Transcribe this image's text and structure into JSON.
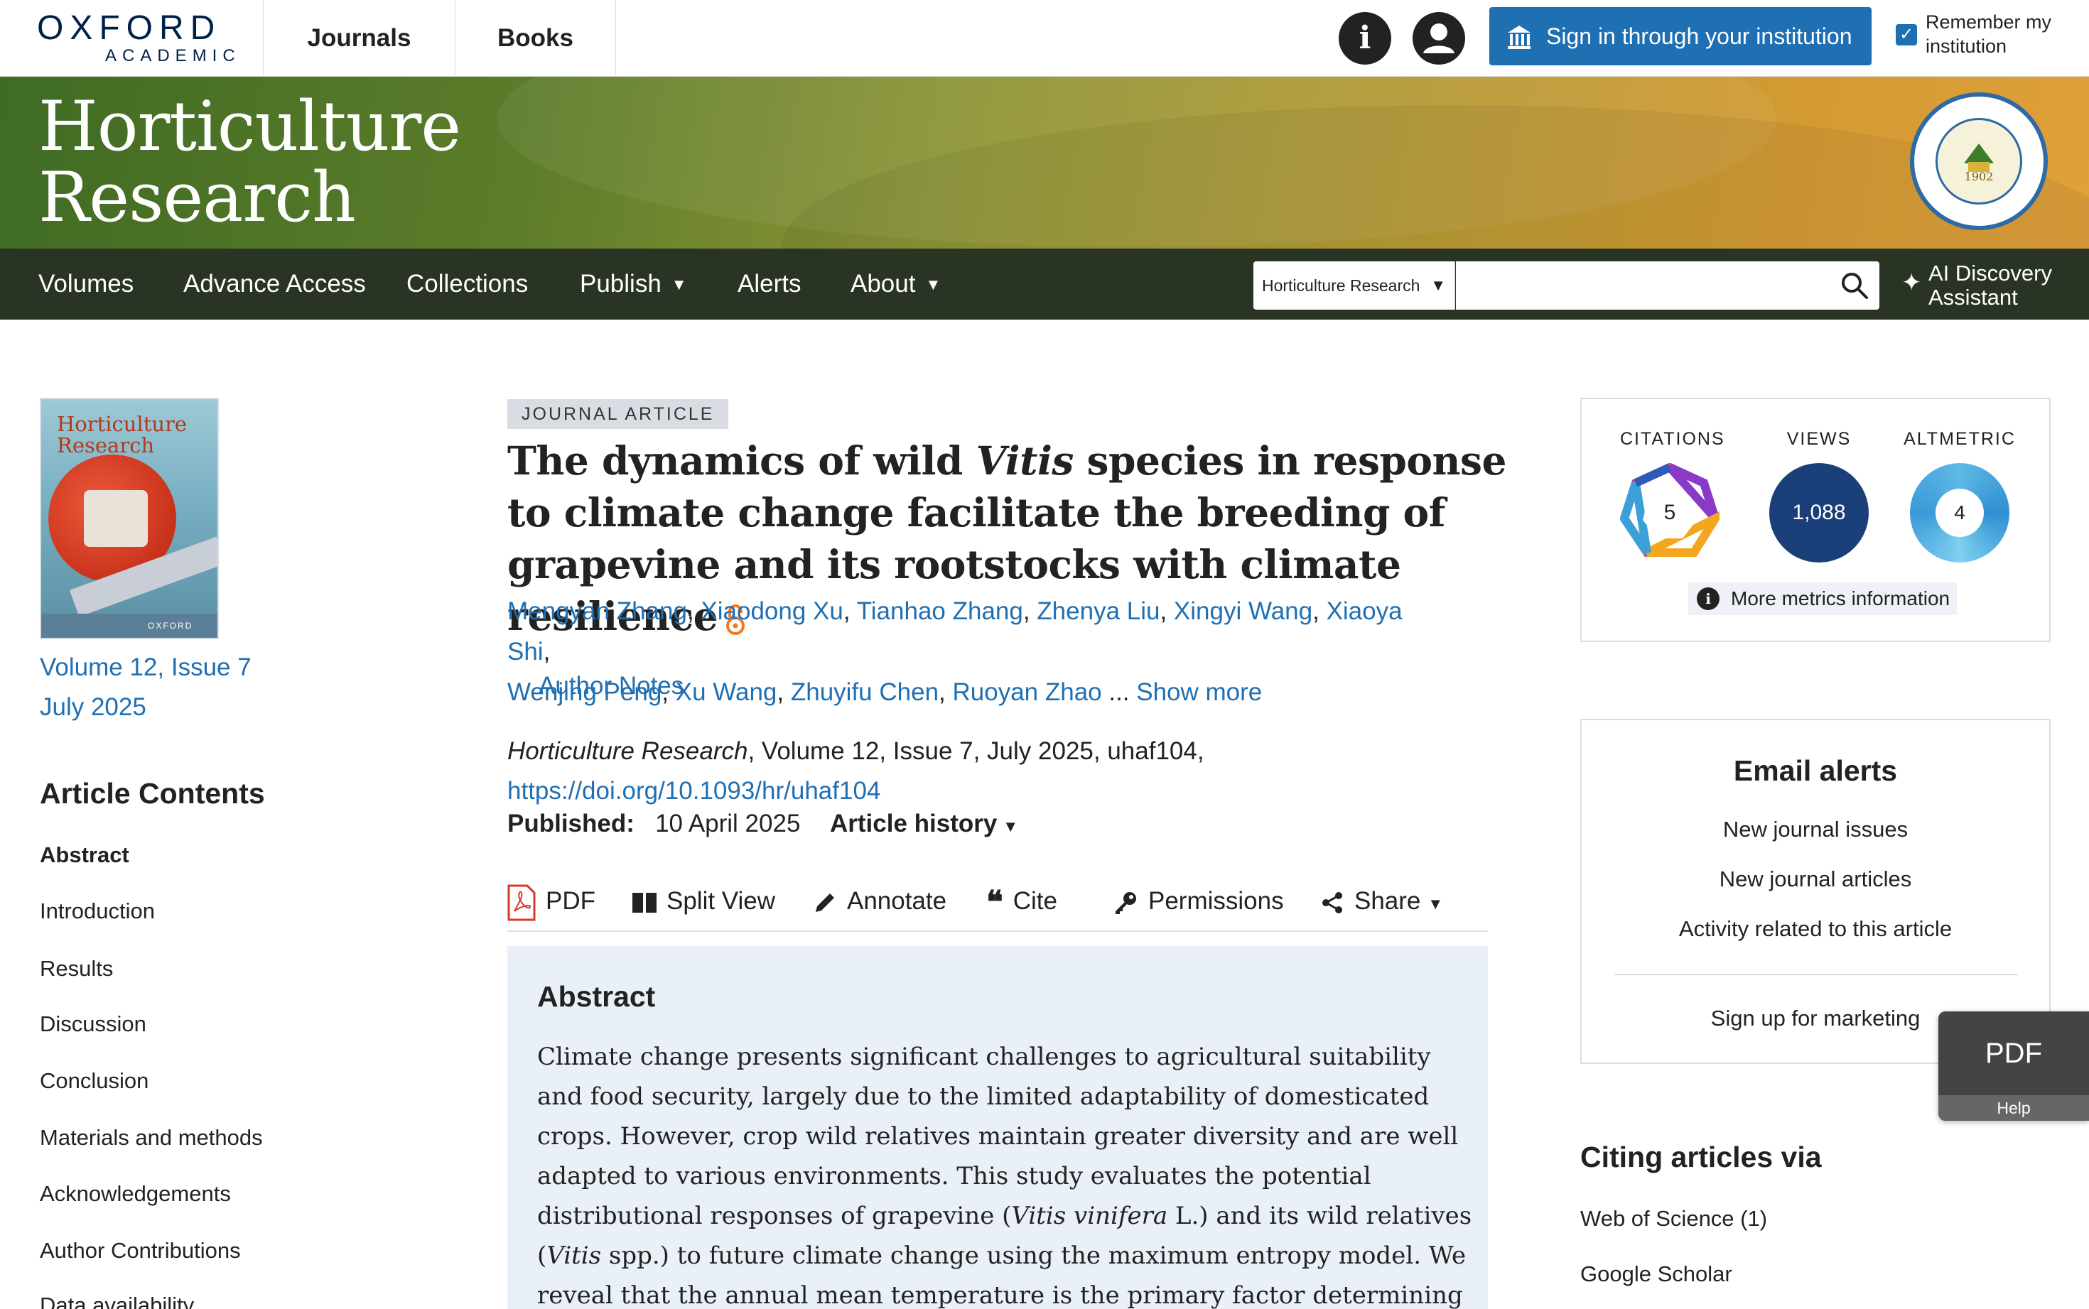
{
  "header": {
    "logo_line1": "OXFORD",
    "logo_line2": "ACADEMIC",
    "nav": [
      "Journals",
      "Books"
    ],
    "signin_label": "Sign in through your institution",
    "remember_label": "Remember my institution",
    "remember_checked": true
  },
  "banner": {
    "journal_title_line1": "Horticulture",
    "journal_title_line2": "Research",
    "seal_year": "1902"
  },
  "nav": {
    "items": [
      {
        "label": "Volumes",
        "dropdown": false
      },
      {
        "label": "Advance Access",
        "dropdown": false
      },
      {
        "label": "Collections",
        "dropdown": false
      },
      {
        "label": "Publish",
        "dropdown": true
      },
      {
        "label": "Alerts",
        "dropdown": false
      },
      {
        "label": "About",
        "dropdown": true
      }
    ],
    "search_scope": "Horticulture Research",
    "search_value": "",
    "ai_label_line1": "AI Discovery",
    "ai_label_line2": "Assistant"
  },
  "sidebar": {
    "cover_title_line1": "Horticulture",
    "cover_title_line2": "Research",
    "cover_footer": "OXFORD",
    "issue_line1": "Volume 12, Issue 7",
    "issue_line2": "July 2025",
    "contents_title": "Article Contents",
    "toc": [
      {
        "label": "Abstract",
        "active": true
      },
      {
        "label": "Introduction",
        "active": false
      },
      {
        "label": "Results",
        "active": false
      },
      {
        "label": "Discussion",
        "active": false
      },
      {
        "label": "Conclusion",
        "active": false
      },
      {
        "label": "Materials and methods",
        "active": false
      },
      {
        "label": "Acknowledgements",
        "active": false
      },
      {
        "label": "Author Contributions",
        "active": false
      },
      {
        "label": "Data availability",
        "active": false
      }
    ]
  },
  "article": {
    "badge": "JOURNAL ARTICLE",
    "title_part1": "The dynamics of wild ",
    "title_italic": "Vitis",
    "title_part2": " species in response to climate change facilitate the breeding of grapevine and its rootstocks with climate resilience",
    "authors": [
      "Mengyan Zhang",
      "Xiaodong Xu",
      "Tianhao Zhang",
      "Zhenya Liu",
      "Xingyi Wang",
      "Xiaoya Shi",
      "Wenjing Peng",
      "Xu Wang",
      "Zhuyifu Chen",
      "Ruoyan Zhao"
    ],
    "ellipsis": " ... ",
    "show_more": "Show more",
    "author_notes": "Author Notes",
    "journal_name": "Horticulture Research",
    "citation_rest": ", Volume 12, Issue 7, July 2025, uhaf104,",
    "doi": "https://doi.org/10.1093/hr/uhaf104",
    "published_label": "Published:",
    "published_date": "10 April 2025",
    "history_label": "Article history"
  },
  "tools": {
    "pdf": "PDF",
    "split": "Split View",
    "annotate": "Annotate",
    "cite": "Cite",
    "permissions": "Permissions",
    "share": "Share"
  },
  "abstract": {
    "heading": "Abstract",
    "p1": "Climate change presents significant challenges to agricultural suitability and food security, largely due to the limited adaptability of domesticated crops. However, crop wild relatives maintain greater diversity and are well adapted to various environments. This study evaluates the potential distributional responses of grapevine (",
    "p_i1": "Vitis vinifera",
    "p2": " L.) and its wild relatives (",
    "p_i2": "Vitis",
    "p3": " spp.) to future climate change using the maximum entropy model. We reveal that the annual mean temperature is the primary factor determining the potential distribution of"
  },
  "metrics": {
    "citations_label": "CITATIONS",
    "citations_value": "5",
    "views_label": "VIEWS",
    "views_value": "1,088",
    "altmetric_label": "ALTMETRIC",
    "altmetric_value": "4",
    "more_label": "More metrics information"
  },
  "alerts": {
    "title": "Email alerts",
    "links": [
      "New journal issues",
      "New journal articles",
      "Activity related to this article"
    ],
    "marketing": "Sign up for marketing"
  },
  "citing": {
    "title": "Citing articles via",
    "links": [
      "Web of Science (1)",
      "Google Scholar"
    ]
  },
  "floating": {
    "pdf": "PDF",
    "help": "Help"
  },
  "colors": {
    "link": "#1f6fb3",
    "nav_bg": "#2a3424",
    "oxford_navy": "#002147",
    "views_circle": "#1b3f78",
    "open_access": "#f37a20"
  }
}
